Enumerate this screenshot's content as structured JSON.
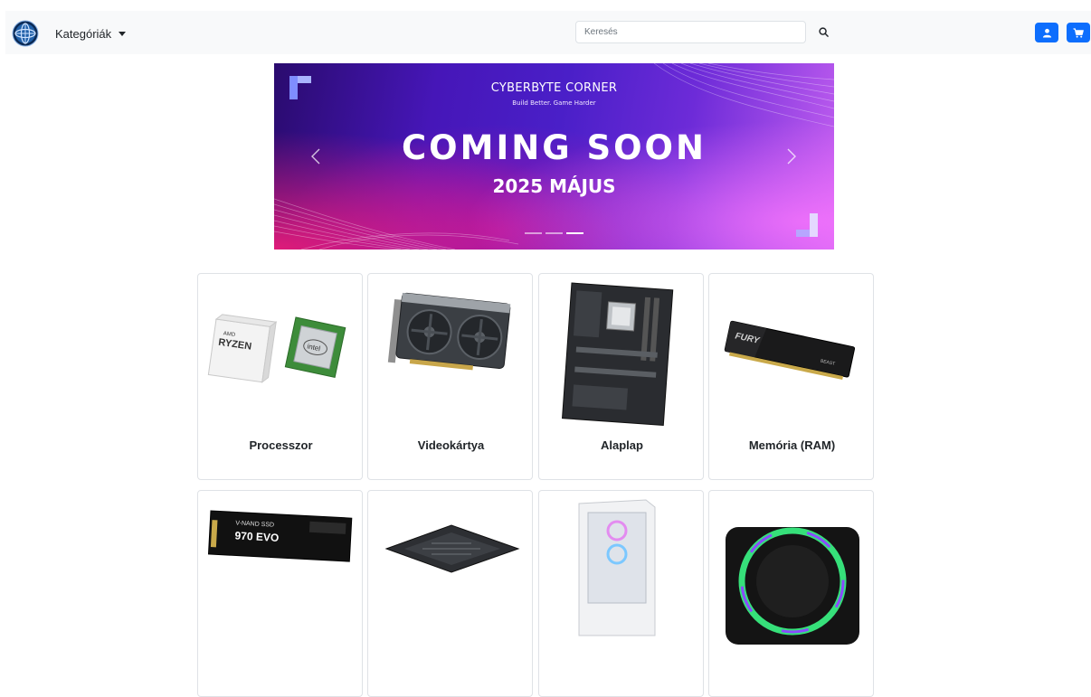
{
  "navbar": {
    "categories_label": "Kategóriák",
    "search_placeholder": "Keresés"
  },
  "banner": {
    "brand": "CYBERBYTE CORNER",
    "tagline": "Build Better. Game Harder",
    "headline": "COMING SOON",
    "subline": "2025 MÁJUS",
    "slides": 3,
    "active_slide": 3
  },
  "categories": [
    {
      "label": "Processzor",
      "icon": "cpu-image",
      "text_on_image": [
        "AMD",
        "RYZEN",
        "intel"
      ]
    },
    {
      "label": "Videokártya",
      "icon": "gpu-image"
    },
    {
      "label": "Alaplap",
      "icon": "motherboard-image"
    },
    {
      "label": "Memória (RAM)",
      "icon": "ram-image",
      "text_on_image": [
        "FURY",
        "BEAST"
      ]
    },
    {
      "label": "",
      "icon": "ssd-image",
      "text_on_image": [
        "V-NAND SSD",
        "970 EVO"
      ]
    },
    {
      "label": "",
      "icon": "psu-image"
    },
    {
      "label": "",
      "icon": "pc-case-image"
    },
    {
      "label": "",
      "icon": "rgb-fan-image"
    }
  ],
  "colors": {
    "primary": "#0d6efd",
    "navbar_bg": "#f8f9fa",
    "card_border": "#dfe2e6"
  }
}
